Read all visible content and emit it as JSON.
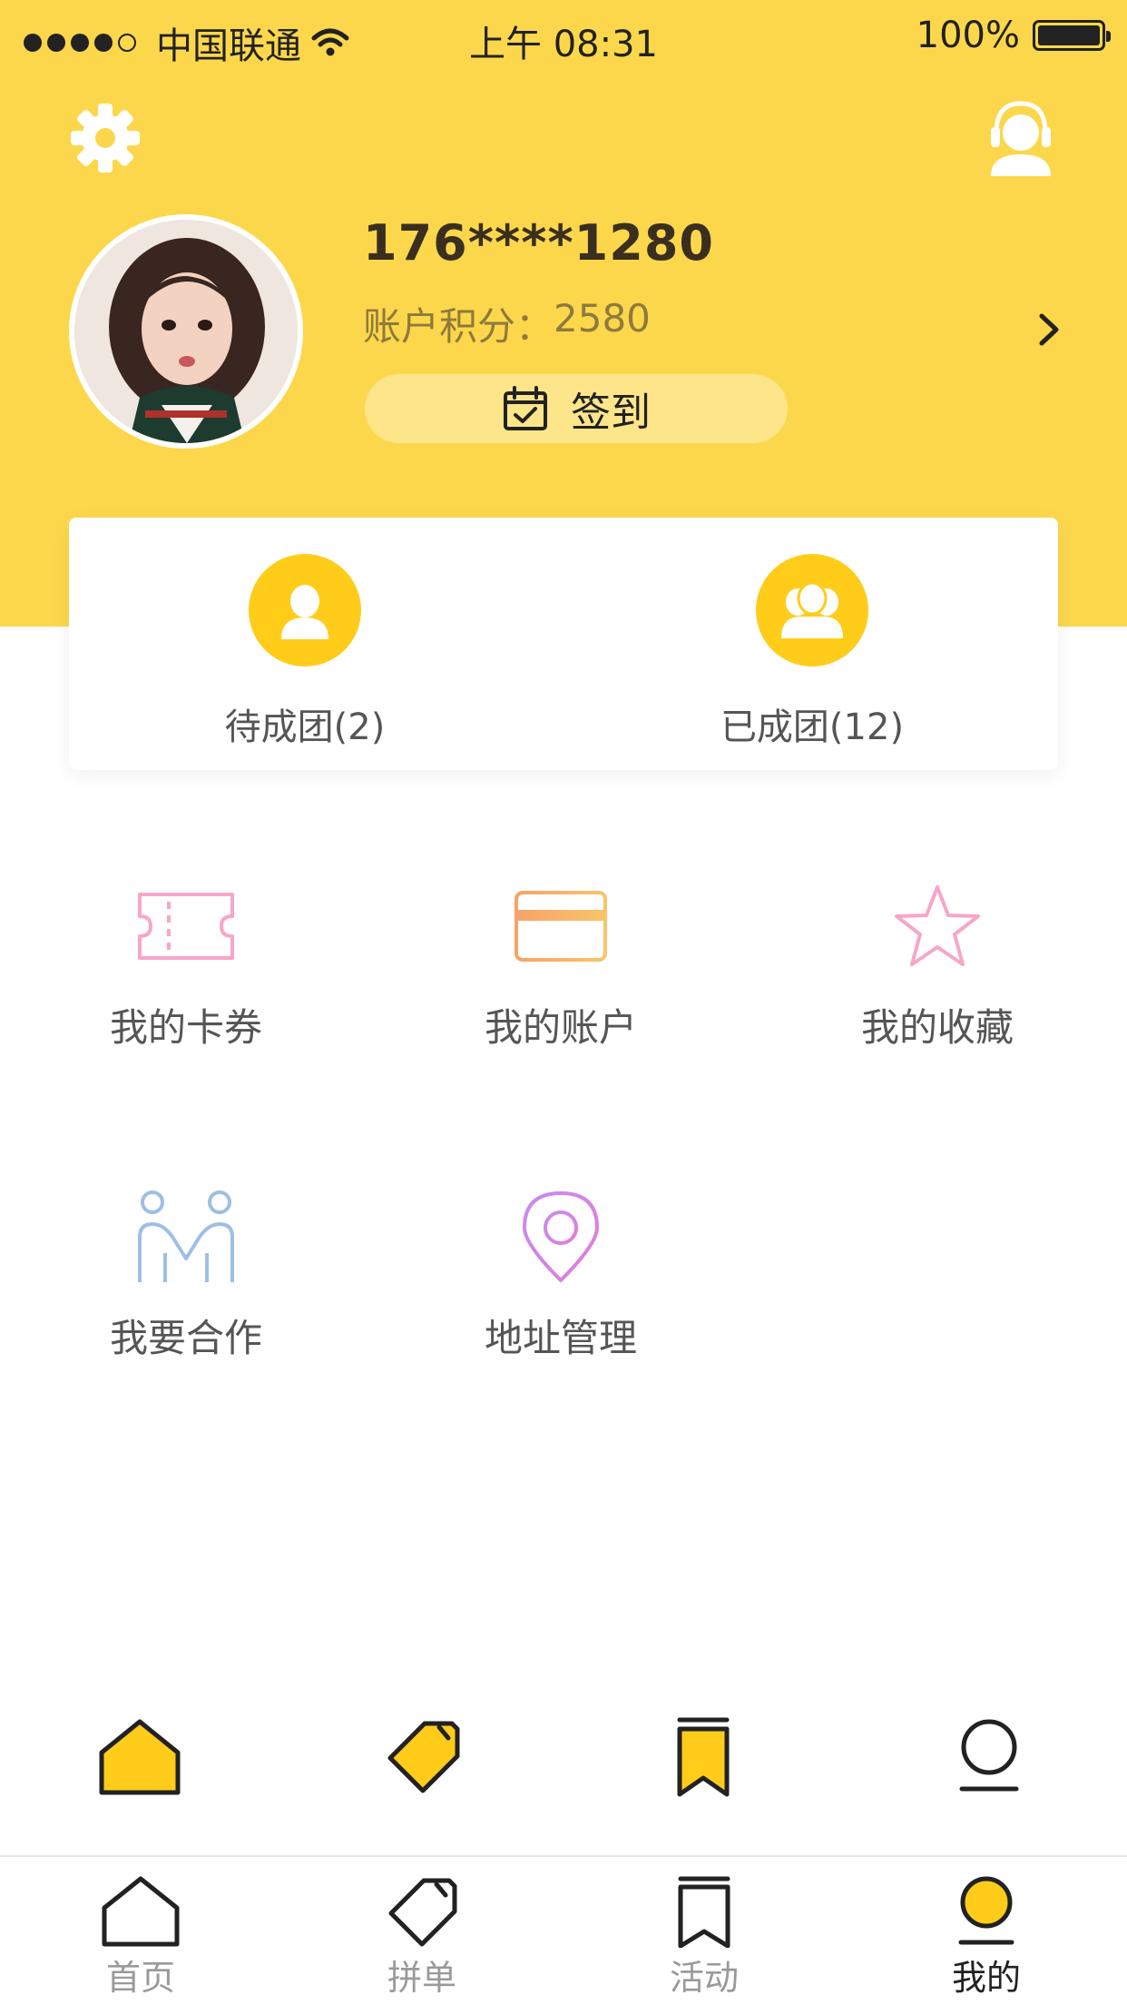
{
  "status_bar": {
    "carrier": "中国联通",
    "time": "上午 08:31",
    "battery": "100%"
  },
  "profile": {
    "phone": "176****1280",
    "points_label": "账户积分：",
    "points_value": "2580",
    "checkin_label": "签到"
  },
  "groups": [
    {
      "label": "待成团(2)"
    },
    {
      "label": "已成团(12)"
    }
  ],
  "menu": [
    {
      "label": "我的卡券"
    },
    {
      "label": "我的账户"
    },
    {
      "label": "我的收藏"
    },
    {
      "label": "我要合作"
    },
    {
      "label": "地址管理"
    }
  ],
  "tabs": [
    {
      "label": "首页"
    },
    {
      "label": "拼单"
    },
    {
      "label": "活动"
    },
    {
      "label": "我的"
    }
  ],
  "active_tab": "我的",
  "colors": {
    "header": "#FDD74B",
    "accent": "#FFCC1A",
    "checkin_pill": "#FDE58A"
  }
}
